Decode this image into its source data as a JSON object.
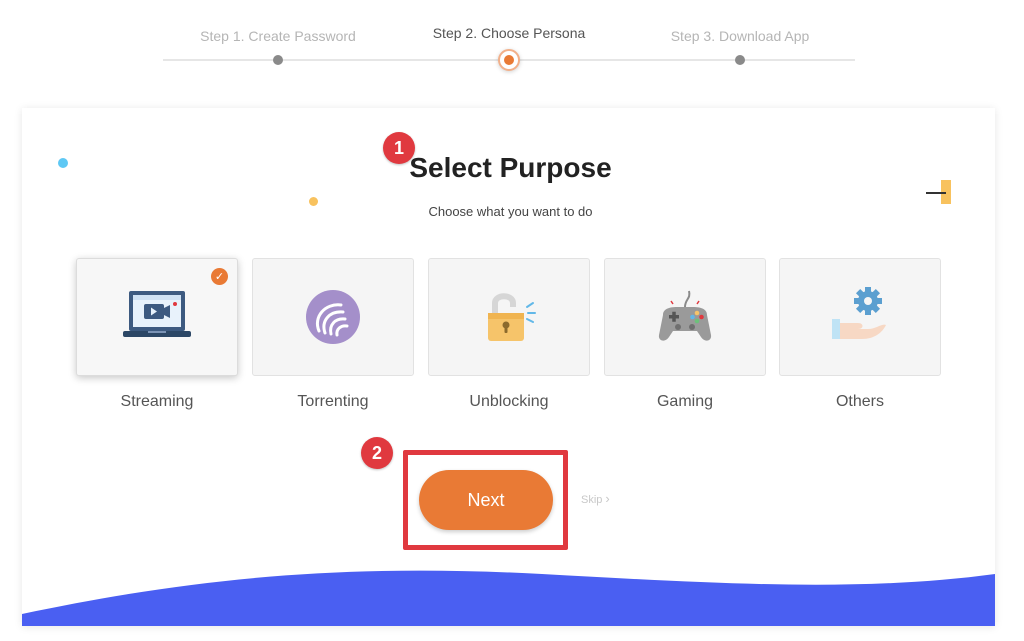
{
  "stepper": {
    "steps": [
      {
        "label": "Step 1. Create Password",
        "state": "inactive"
      },
      {
        "label": "Step 2. Choose Persona",
        "state": "active"
      },
      {
        "label": "Step 3. Download App",
        "state": "inactive"
      }
    ]
  },
  "main": {
    "title": "Select Purpose",
    "subtitle": "Choose what you want to do",
    "callouts": [
      "1",
      "2"
    ],
    "options": [
      {
        "label": "Streaming",
        "icon": "laptop-video-icon",
        "selected": true
      },
      {
        "label": "Torrenting",
        "icon": "torrent-icon",
        "selected": false
      },
      {
        "label": "Unblocking",
        "icon": "padlock-icon",
        "selected": false
      },
      {
        "label": "Gaming",
        "icon": "gamepad-icon",
        "selected": false
      },
      {
        "label": "Others",
        "icon": "gear-hand-icon",
        "selected": false
      }
    ],
    "next_label": "Next",
    "skip_label": "Skip"
  },
  "colors": {
    "accent": "#e97a35",
    "callout": "#e0393f",
    "wave": "#4a5ff2",
    "tile_bg": "#f5f5f5"
  }
}
